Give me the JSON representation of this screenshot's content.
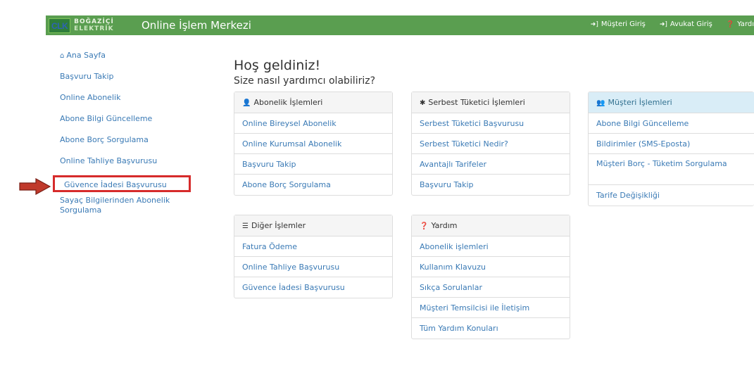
{
  "navbar": {
    "logo": {
      "mark": "CLK",
      "line1": "BOĞAZİÇİ",
      "line2": "ELEKTRİK"
    },
    "title": "Online İşlem Merkezi",
    "links": [
      {
        "icon": "sign-in-icon",
        "label": "Müşteri Giriş"
      },
      {
        "icon": "sign-in-icon",
        "label": "Avukat Giriş"
      },
      {
        "icon": "question-circle-icon",
        "label": "Yardı"
      }
    ]
  },
  "sidebar": {
    "items": [
      {
        "label": "Ana Sayfa",
        "icon": "home-icon"
      },
      {
        "label": "Başvuru Takip"
      },
      {
        "label": "Online Abonelik"
      },
      {
        "label": "Abone Bilgi Güncelleme"
      },
      {
        "label": "Abone Borç Sorgulama"
      },
      {
        "label": "Online Tahliye Başvurusu"
      },
      {
        "label": "Güvence İadesi Başvurusu",
        "highlighted": true
      },
      {
        "label": "Sayaç Bilgilerinden Abonelik Sorgulama"
      }
    ]
  },
  "main": {
    "welcome": "Hoş geldiniz!",
    "subtitle": "Size nasıl yardımcı olabiliriz?"
  },
  "panels": {
    "abonelik": {
      "title": "Abonelik İşlemleri",
      "icon": "user-icon",
      "items": [
        "Online Bireysel Abonelik",
        "Online Kurumsal Abonelik",
        "Başvuru Takip",
        "Abone Borç Sorgulama"
      ]
    },
    "serbest": {
      "title": "Serbest Tüketici İşlemleri",
      "icon": "asterisk-icon",
      "items": [
        "Serbest Tüketici Başvurusu",
        "Serbest Tüketici Nedir?",
        "Avantajlı Tarifeler",
        "Başvuru Takip"
      ]
    },
    "musteri": {
      "title": "Müşteri İşlemleri",
      "icon": "users-icon",
      "items": [
        "Abone Bilgi Güncelleme",
        "Bildirimler (SMS-Eposta)",
        "Müşteri Borç - Tüketim Sorgulama",
        "Tarife Değişikliği"
      ]
    },
    "diger": {
      "title": "Diğer İşlemler",
      "icon": "list-icon",
      "items": [
        "Fatura Ödeme",
        "Online Tahliye Başvurusu",
        "Güvence İadesi Başvurusu"
      ]
    },
    "yardim": {
      "title": "Yardım",
      "icon": "question-circle-icon",
      "items": [
        "Abonelik işlemleri",
        "Kullanım Klavuzu",
        "Sıkça Sorulanlar",
        "Müşteri Temsilcisi ile İletişim",
        "Tüm Yardım Konuları"
      ]
    }
  },
  "colors": {
    "navbar": "#5a9e50",
    "link": "#3a7ab5",
    "highlight_border": "#d62b2b",
    "arrow": "#c0392b",
    "info_header": "#d9edf7"
  }
}
